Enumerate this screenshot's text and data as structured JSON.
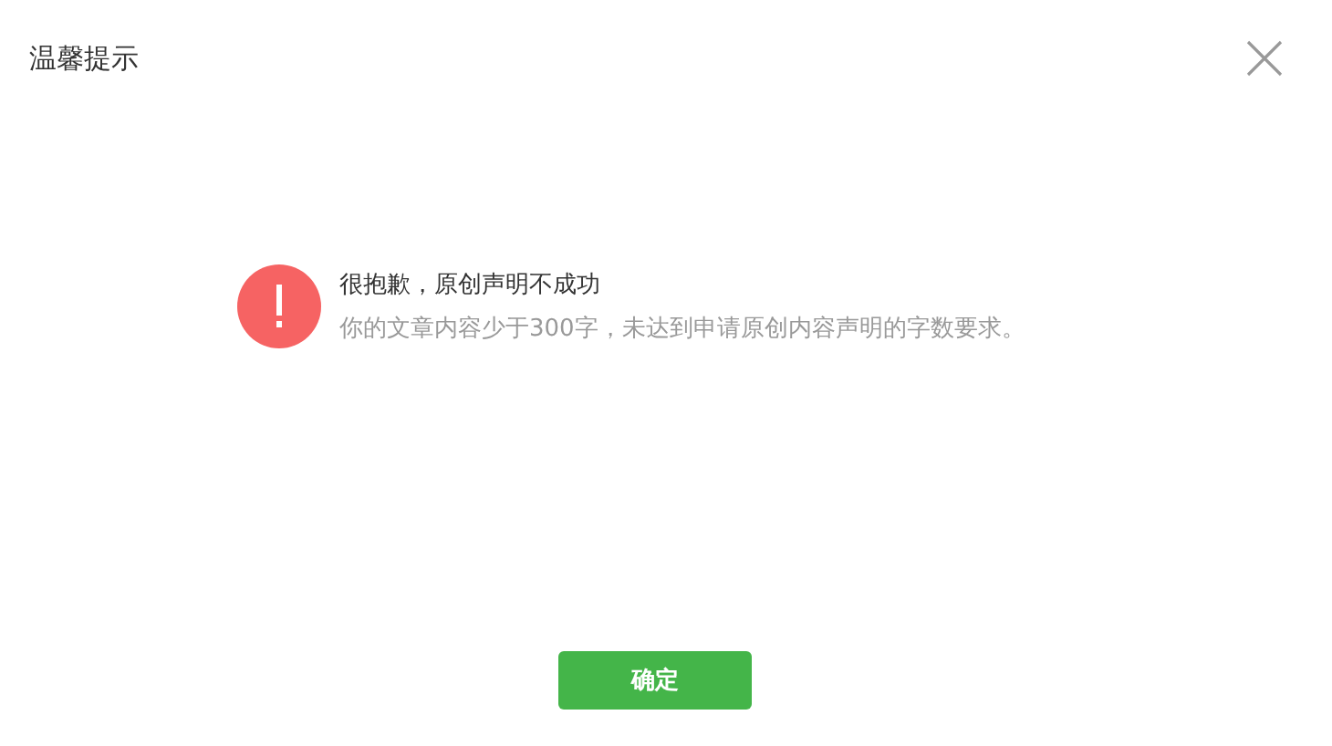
{
  "dialog": {
    "title": "温馨提示",
    "message": {
      "title": "很抱歉，原创声明不成功",
      "detail": "你的文章内容少于300字，未达到申请原创内容声明的字数要求。"
    },
    "buttons": [
      "确定"
    ]
  }
}
